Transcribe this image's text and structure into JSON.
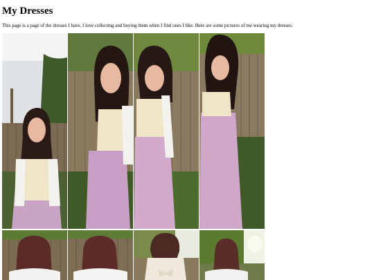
{
  "page": {
    "title": "My Dresses",
    "intro": "This page is a page of the dresses I have, I love collecting and buying them when I find ones I like. Here are some pictures of me wearing my dresses."
  },
  "gallery": {
    "rows": [
      {
        "photos": [
          {
            "subject": "front-view-dress-photo",
            "dress_color": "#c9a3c6",
            "hair_color": "#2a1a16"
          },
          {
            "subject": "front-view-dress-photo",
            "dress_color": "#c79ec4",
            "hair_color": "#241612"
          },
          {
            "subject": "front-view-dress-photo",
            "dress_color": "#d2aacb",
            "hair_color": "#261814"
          },
          {
            "subject": "front-view-dress-photo",
            "dress_color": "#cfa7c9",
            "hair_color": "#221410"
          }
        ]
      },
      {
        "photos": [
          {
            "subject": "back-view-dress-photo",
            "top_color": "#f2f2f0",
            "hair_color": "#5a2a26"
          },
          {
            "subject": "back-view-dress-photo",
            "top_color": "#f4f4f2",
            "hair_color": "#5e2c28"
          },
          {
            "subject": "back-view-dress-photo",
            "top_color": "#efe9dc",
            "hair_color": "#4a2a22"
          },
          {
            "subject": "back-view-dress-photo",
            "top_color": "#f1f1ef",
            "hair_color": "#5a2e28"
          }
        ]
      }
    ]
  },
  "colors": {
    "fence": "#8a7a60",
    "grass": "#4e6b2e",
    "sky": "#d8dde0",
    "skin": "#e6b9a0",
    "bodice": "#efe6c8"
  }
}
